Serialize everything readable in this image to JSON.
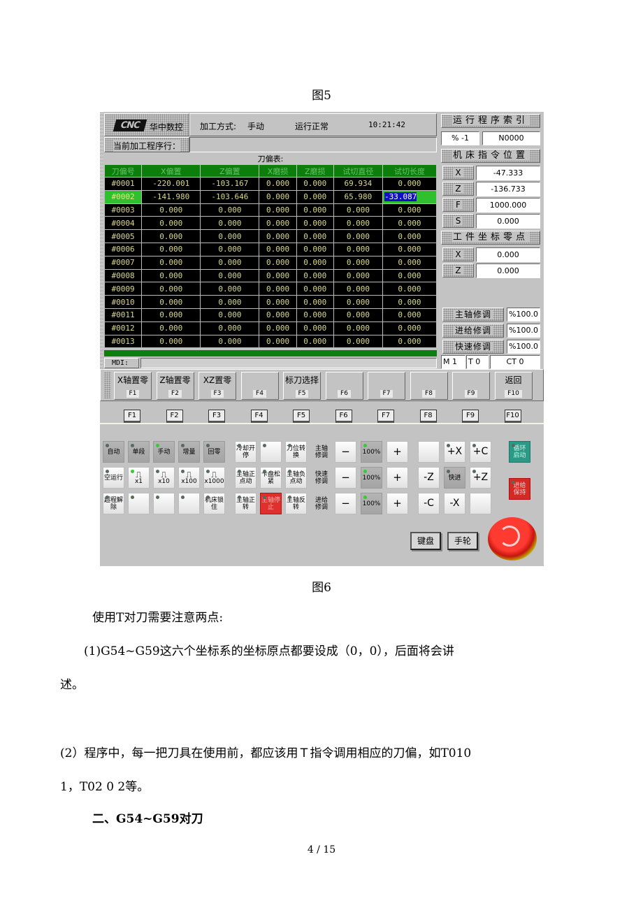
{
  "doc": {
    "caption_fig5": "图5",
    "caption_fig6": "图6",
    "para1": "使用T对刀需要注意两点:",
    "para2_line1": "(1)G54~G59这六个坐标系的坐标原点都要设成（0，0），后面将会讲",
    "para2_line2": "述。",
    "para3_line1": "(2）程序中，每一把刀具在使用前，都应该用Ｔ指令调用相应的刀偏，如T010",
    "para3_line2": "1，T02 0 2等。",
    "heading": "二、G54~G59对刀",
    "page_number": "4 / 15"
  },
  "cnc": {
    "logo": "CNC",
    "brand": "华中数控",
    "mode_label": "加工方式:",
    "mode_value": "手动",
    "run_status": "运行正常",
    "time": "10:21:42",
    "current_line_label": "当前加工程序行：",
    "table_title": "刀偏表:",
    "table": {
      "headers": [
        "刀偏号",
        "X偏置",
        "Z偏置",
        "X磨损",
        "Z磨损",
        "试切直径",
        "试切长度"
      ],
      "rows": [
        [
          "#0001",
          "-220.001",
          "-103.167",
          "0.000",
          "0.000",
          "69.934",
          "0.000"
        ],
        [
          "#0002",
          "-141.980",
          "-103.646",
          "0.000",
          "0.000",
          "65.980",
          "-33.087"
        ],
        [
          "#0003",
          "0.000",
          "0.000",
          "0.000",
          "0.000",
          "0.000",
          "0.000"
        ],
        [
          "#0004",
          "0.000",
          "0.000",
          "0.000",
          "0.000",
          "0.000",
          "0.000"
        ],
        [
          "#0005",
          "0.000",
          "0.000",
          "0.000",
          "0.000",
          "0.000",
          "0.000"
        ],
        [
          "#0006",
          "0.000",
          "0.000",
          "0.000",
          "0.000",
          "0.000",
          "0.000"
        ],
        [
          "#0007",
          "0.000",
          "0.000",
          "0.000",
          "0.000",
          "0.000",
          "0.000"
        ],
        [
          "#0008",
          "0.000",
          "0.000",
          "0.000",
          "0.000",
          "0.000",
          "0.000"
        ],
        [
          "#0009",
          "0.000",
          "0.000",
          "0.000",
          "0.000",
          "0.000",
          "0.000"
        ],
        [
          "#0010",
          "0.000",
          "0.000",
          "0.000",
          "0.000",
          "0.000",
          "0.000"
        ],
        [
          "#0011",
          "0.000",
          "0.000",
          "0.000",
          "0.000",
          "0.000",
          "0.000"
        ],
        [
          "#0012",
          "0.000",
          "0.000",
          "0.000",
          "0.000",
          "0.000",
          "0.000"
        ],
        [
          "#0013",
          "0.000",
          "0.000",
          "0.000",
          "0.000",
          "0.000",
          "0.000"
        ]
      ],
      "selected_row": 1,
      "selected_col": 6
    },
    "mdi_label": "MDI:",
    "right": {
      "prog_index_title": "运行程序索引",
      "prog_pct": "% -1",
      "prog_n": "N0000",
      "machine_pos_title": "机床指令位置",
      "machine_pos": [
        {
          "axis": "X",
          "value": "-47.333"
        },
        {
          "axis": "Z",
          "value": "-136.733"
        },
        {
          "axis": "F",
          "value": "1000.000"
        },
        {
          "axis": "S",
          "value": "0.000"
        }
      ],
      "work_zero_title": "工件坐标零点",
      "work_zero": [
        {
          "axis": "X",
          "value": "0.000"
        },
        {
          "axis": "Z",
          "value": "0.000"
        }
      ],
      "overrides": [
        {
          "label": "主轴修调",
          "value": "%100.0"
        },
        {
          "label": "进给修调",
          "value": "%100.0"
        },
        {
          "label": "快速修调",
          "value": "%100.0"
        }
      ],
      "m_value": "M  1",
      "t_value": "T  0",
      "ct_value": "CT  0"
    },
    "softkeys": [
      {
        "label": "X轴置零",
        "key": "F1"
      },
      {
        "label": "Z轴置零",
        "key": "F2"
      },
      {
        "label": "XZ置零",
        "key": "F3"
      },
      {
        "label": "",
        "key": "F4"
      },
      {
        "label": "标刀选择",
        "key": "F5"
      },
      {
        "label": "",
        "key": "F6"
      },
      {
        "label": "",
        "key": "F7"
      },
      {
        "label": "",
        "key": "F8"
      },
      {
        "label": "",
        "key": "F9"
      },
      {
        "label": "返回",
        "key": "F10"
      }
    ],
    "fkeys": [
      "F1",
      "F2",
      "F3",
      "F4",
      "F5",
      "F6",
      "F7",
      "F8",
      "F9",
      "F10"
    ],
    "mode_buttons": [
      [
        "自动",
        "单段",
        "手动",
        "增量",
        "回零"
      ],
      [
        "空运行",
        "x1",
        "x10",
        "x100",
        "x1000"
      ],
      [
        "超程解除",
        "",
        "",
        "",
        "机床锁住"
      ]
    ],
    "spindle_buttons": [
      [
        "冷却开停",
        "",
        "刀位转换"
      ],
      [
        "主轴正点动",
        "卡盘松紧",
        "主轴负点动"
      ],
      [
        "主轴正转",
        "主轴停止",
        "主轴反转"
      ]
    ],
    "override_rows": [
      {
        "label": "主轴修调",
        "minus": "−",
        "value": "100%",
        "plus": "+"
      },
      {
        "label": "快速修调",
        "minus": "−",
        "value": "100%",
        "plus": "+"
      },
      {
        "label": "进给修调",
        "minus": "−",
        "value": "100%",
        "plus": "+"
      }
    ],
    "jog_buttons": [
      [
        "",
        "+X",
        "+C"
      ],
      [
        "-Z",
        "快进",
        "+Z"
      ],
      [
        "-C",
        "-X",
        ""
      ]
    ],
    "cycle_start": "循环启动",
    "feed_hold": "进给保持",
    "keyboard_btn": "键盘",
    "handwheel_btn": "手轮"
  }
}
